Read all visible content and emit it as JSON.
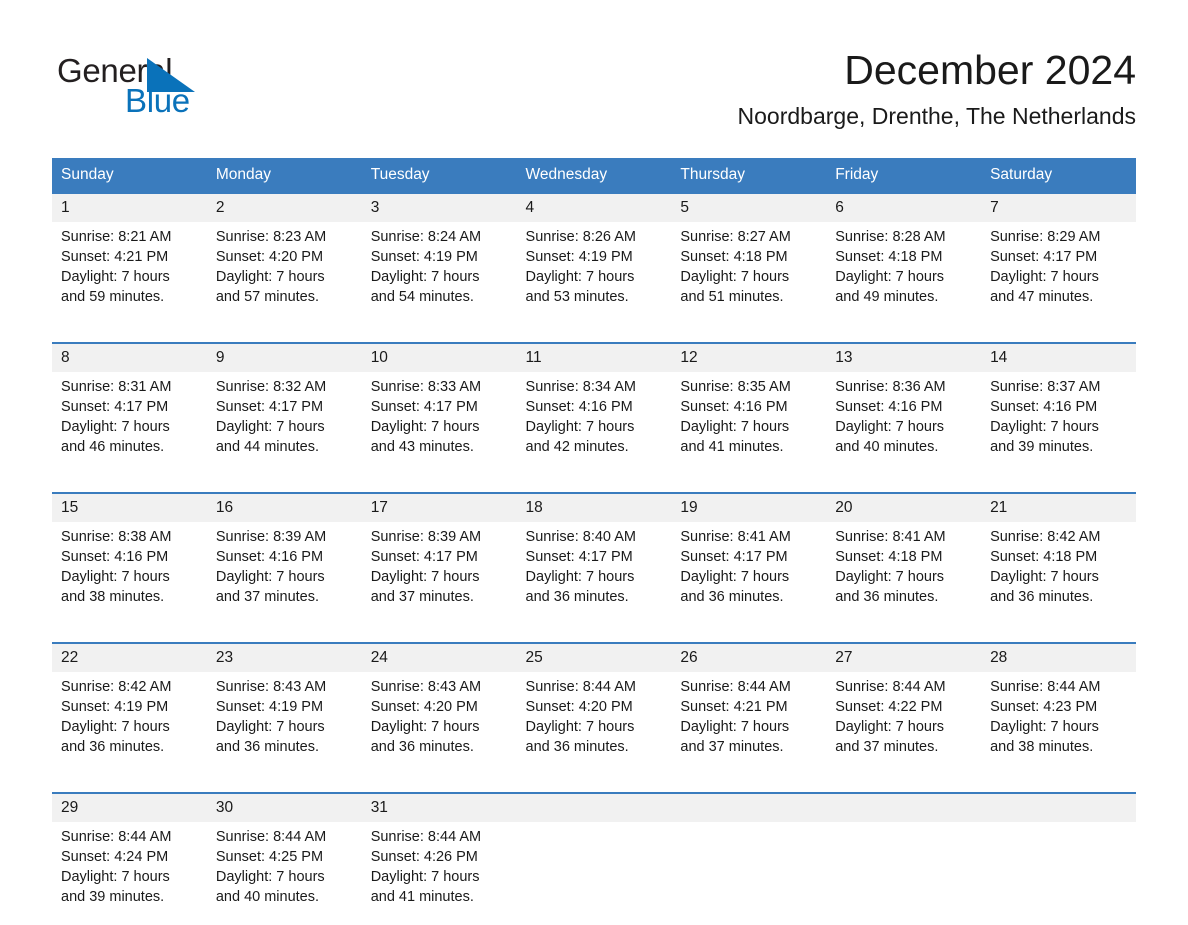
{
  "brand": {
    "name_part1": "General",
    "name_part2": "Blue",
    "triangle_color": "#0a72ba"
  },
  "header": {
    "title": "December 2024",
    "subtitle": "Noordbarge, Drenthe, The Netherlands"
  },
  "theme": {
    "header_blue": "#3a7cbe",
    "daynum_gray": "#f1f1f1",
    "text": "#1a1a1a",
    "brand_blue": "#0a72ba"
  },
  "weekday_headers": [
    "Sunday",
    "Monday",
    "Tuesday",
    "Wednesday",
    "Thursday",
    "Friday",
    "Saturday"
  ],
  "weeks": [
    {
      "days": [
        {
          "num": "1",
          "sunrise": "Sunrise: 8:21 AM",
          "sunset": "Sunset: 4:21 PM",
          "daylight1": "Daylight: 7 hours",
          "daylight2": "and 59 minutes."
        },
        {
          "num": "2",
          "sunrise": "Sunrise: 8:23 AM",
          "sunset": "Sunset: 4:20 PM",
          "daylight1": "Daylight: 7 hours",
          "daylight2": "and 57 minutes."
        },
        {
          "num": "3",
          "sunrise": "Sunrise: 8:24 AM",
          "sunset": "Sunset: 4:19 PM",
          "daylight1": "Daylight: 7 hours",
          "daylight2": "and 54 minutes."
        },
        {
          "num": "4",
          "sunrise": "Sunrise: 8:26 AM",
          "sunset": "Sunset: 4:19 PM",
          "daylight1": "Daylight: 7 hours",
          "daylight2": "and 53 minutes."
        },
        {
          "num": "5",
          "sunrise": "Sunrise: 8:27 AM",
          "sunset": "Sunset: 4:18 PM",
          "daylight1": "Daylight: 7 hours",
          "daylight2": "and 51 minutes."
        },
        {
          "num": "6",
          "sunrise": "Sunrise: 8:28 AM",
          "sunset": "Sunset: 4:18 PM",
          "daylight1": "Daylight: 7 hours",
          "daylight2": "and 49 minutes."
        },
        {
          "num": "7",
          "sunrise": "Sunrise: 8:29 AM",
          "sunset": "Sunset: 4:17 PM",
          "daylight1": "Daylight: 7 hours",
          "daylight2": "and 47 minutes."
        }
      ]
    },
    {
      "days": [
        {
          "num": "8",
          "sunrise": "Sunrise: 8:31 AM",
          "sunset": "Sunset: 4:17 PM",
          "daylight1": "Daylight: 7 hours",
          "daylight2": "and 46 minutes."
        },
        {
          "num": "9",
          "sunrise": "Sunrise: 8:32 AM",
          "sunset": "Sunset: 4:17 PM",
          "daylight1": "Daylight: 7 hours",
          "daylight2": "and 44 minutes."
        },
        {
          "num": "10",
          "sunrise": "Sunrise: 8:33 AM",
          "sunset": "Sunset: 4:17 PM",
          "daylight1": "Daylight: 7 hours",
          "daylight2": "and 43 minutes."
        },
        {
          "num": "11",
          "sunrise": "Sunrise: 8:34 AM",
          "sunset": "Sunset: 4:16 PM",
          "daylight1": "Daylight: 7 hours",
          "daylight2": "and 42 minutes."
        },
        {
          "num": "12",
          "sunrise": "Sunrise: 8:35 AM",
          "sunset": "Sunset: 4:16 PM",
          "daylight1": "Daylight: 7 hours",
          "daylight2": "and 41 minutes."
        },
        {
          "num": "13",
          "sunrise": "Sunrise: 8:36 AM",
          "sunset": "Sunset: 4:16 PM",
          "daylight1": "Daylight: 7 hours",
          "daylight2": "and 40 minutes."
        },
        {
          "num": "14",
          "sunrise": "Sunrise: 8:37 AM",
          "sunset": "Sunset: 4:16 PM",
          "daylight1": "Daylight: 7 hours",
          "daylight2": "and 39 minutes."
        }
      ]
    },
    {
      "days": [
        {
          "num": "15",
          "sunrise": "Sunrise: 8:38 AM",
          "sunset": "Sunset: 4:16 PM",
          "daylight1": "Daylight: 7 hours",
          "daylight2": "and 38 minutes."
        },
        {
          "num": "16",
          "sunrise": "Sunrise: 8:39 AM",
          "sunset": "Sunset: 4:16 PM",
          "daylight1": "Daylight: 7 hours",
          "daylight2": "and 37 minutes."
        },
        {
          "num": "17",
          "sunrise": "Sunrise: 8:39 AM",
          "sunset": "Sunset: 4:17 PM",
          "daylight1": "Daylight: 7 hours",
          "daylight2": "and 37 minutes."
        },
        {
          "num": "18",
          "sunrise": "Sunrise: 8:40 AM",
          "sunset": "Sunset: 4:17 PM",
          "daylight1": "Daylight: 7 hours",
          "daylight2": "and 36 minutes."
        },
        {
          "num": "19",
          "sunrise": "Sunrise: 8:41 AM",
          "sunset": "Sunset: 4:17 PM",
          "daylight1": "Daylight: 7 hours",
          "daylight2": "and 36 minutes."
        },
        {
          "num": "20",
          "sunrise": "Sunrise: 8:41 AM",
          "sunset": "Sunset: 4:18 PM",
          "daylight1": "Daylight: 7 hours",
          "daylight2": "and 36 minutes."
        },
        {
          "num": "21",
          "sunrise": "Sunrise: 8:42 AM",
          "sunset": "Sunset: 4:18 PM",
          "daylight1": "Daylight: 7 hours",
          "daylight2": "and 36 minutes."
        }
      ]
    },
    {
      "days": [
        {
          "num": "22",
          "sunrise": "Sunrise: 8:42 AM",
          "sunset": "Sunset: 4:19 PM",
          "daylight1": "Daylight: 7 hours",
          "daylight2": "and 36 minutes."
        },
        {
          "num": "23",
          "sunrise": "Sunrise: 8:43 AM",
          "sunset": "Sunset: 4:19 PM",
          "daylight1": "Daylight: 7 hours",
          "daylight2": "and 36 minutes."
        },
        {
          "num": "24",
          "sunrise": "Sunrise: 8:43 AM",
          "sunset": "Sunset: 4:20 PM",
          "daylight1": "Daylight: 7 hours",
          "daylight2": "and 36 minutes."
        },
        {
          "num": "25",
          "sunrise": "Sunrise: 8:44 AM",
          "sunset": "Sunset: 4:20 PM",
          "daylight1": "Daylight: 7 hours",
          "daylight2": "and 36 minutes."
        },
        {
          "num": "26",
          "sunrise": "Sunrise: 8:44 AM",
          "sunset": "Sunset: 4:21 PM",
          "daylight1": "Daylight: 7 hours",
          "daylight2": "and 37 minutes."
        },
        {
          "num": "27",
          "sunrise": "Sunrise: 8:44 AM",
          "sunset": "Sunset: 4:22 PM",
          "daylight1": "Daylight: 7 hours",
          "daylight2": "and 37 minutes."
        },
        {
          "num": "28",
          "sunrise": "Sunrise: 8:44 AM",
          "sunset": "Sunset: 4:23 PM",
          "daylight1": "Daylight: 7 hours",
          "daylight2": "and 38 minutes."
        }
      ]
    },
    {
      "days": [
        {
          "num": "29",
          "sunrise": "Sunrise: 8:44 AM",
          "sunset": "Sunset: 4:24 PM",
          "daylight1": "Daylight: 7 hours",
          "daylight2": "and 39 minutes."
        },
        {
          "num": "30",
          "sunrise": "Sunrise: 8:44 AM",
          "sunset": "Sunset: 4:25 PM",
          "daylight1": "Daylight: 7 hours",
          "daylight2": "and 40 minutes."
        },
        {
          "num": "31",
          "sunrise": "Sunrise: 8:44 AM",
          "sunset": "Sunset: 4:26 PM",
          "daylight1": "Daylight: 7 hours",
          "daylight2": "and 41 minutes."
        },
        {
          "num": "",
          "sunrise": "",
          "sunset": "",
          "daylight1": "",
          "daylight2": ""
        },
        {
          "num": "",
          "sunrise": "",
          "sunset": "",
          "daylight1": "",
          "daylight2": ""
        },
        {
          "num": "",
          "sunrise": "",
          "sunset": "",
          "daylight1": "",
          "daylight2": ""
        },
        {
          "num": "",
          "sunrise": "",
          "sunset": "",
          "daylight1": "",
          "daylight2": ""
        }
      ]
    }
  ]
}
